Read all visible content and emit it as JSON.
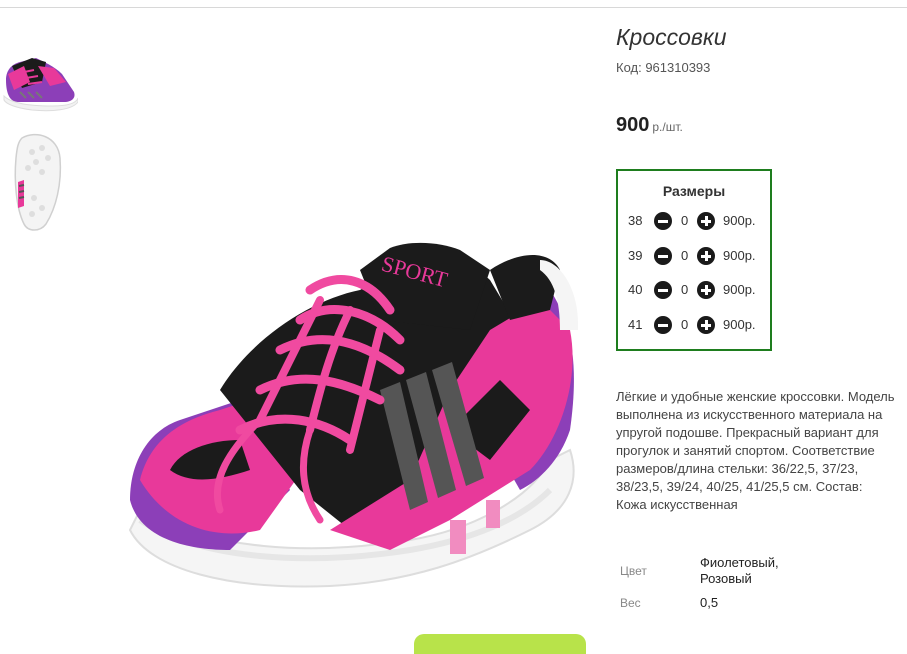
{
  "product": {
    "title": "Кроссовки",
    "code": "Код: 961310393",
    "price_amount": "900",
    "price_unit": "р./шт."
  },
  "thumbnails": [
    {
      "label": "shoe-side-view"
    },
    {
      "label": "shoe-sole-view"
    }
  ],
  "main_image": {
    "tongue_text": "SPORT"
  },
  "sizes": {
    "title": "Размеры",
    "rows": [
      {
        "size": "38",
        "qty": "0",
        "price": "900р."
      },
      {
        "size": "39",
        "qty": "0",
        "price": "900р."
      },
      {
        "size": "40",
        "qty": "0",
        "price": "900р."
      },
      {
        "size": "41",
        "qty": "0",
        "price": "900р."
      }
    ]
  },
  "description": "Лёгкие и удобные женские кроссовки. Модель выполнена из искусственного материала на упругой подошве. Прекрасный вариант для прогулок и занятий спортом. Соответствие размеров/длина стельки: 36/22,5, 37/23, 38/23,5, 39/24, 40/25, 41/25,5 см. Состав: Кожа искусственная",
  "properties": [
    {
      "label": "Цвет",
      "value": "Фиолетовый, Розовый"
    },
    {
      "label": "Вес",
      "value": "0,5"
    }
  ],
  "colors": {
    "sizes_border": "#1e7d1e",
    "cart_button": "#b8e34a",
    "shoe_pink": "#e8399a",
    "shoe_purple": "#8c3fb8",
    "shoe_black": "#1b1b1b"
  }
}
